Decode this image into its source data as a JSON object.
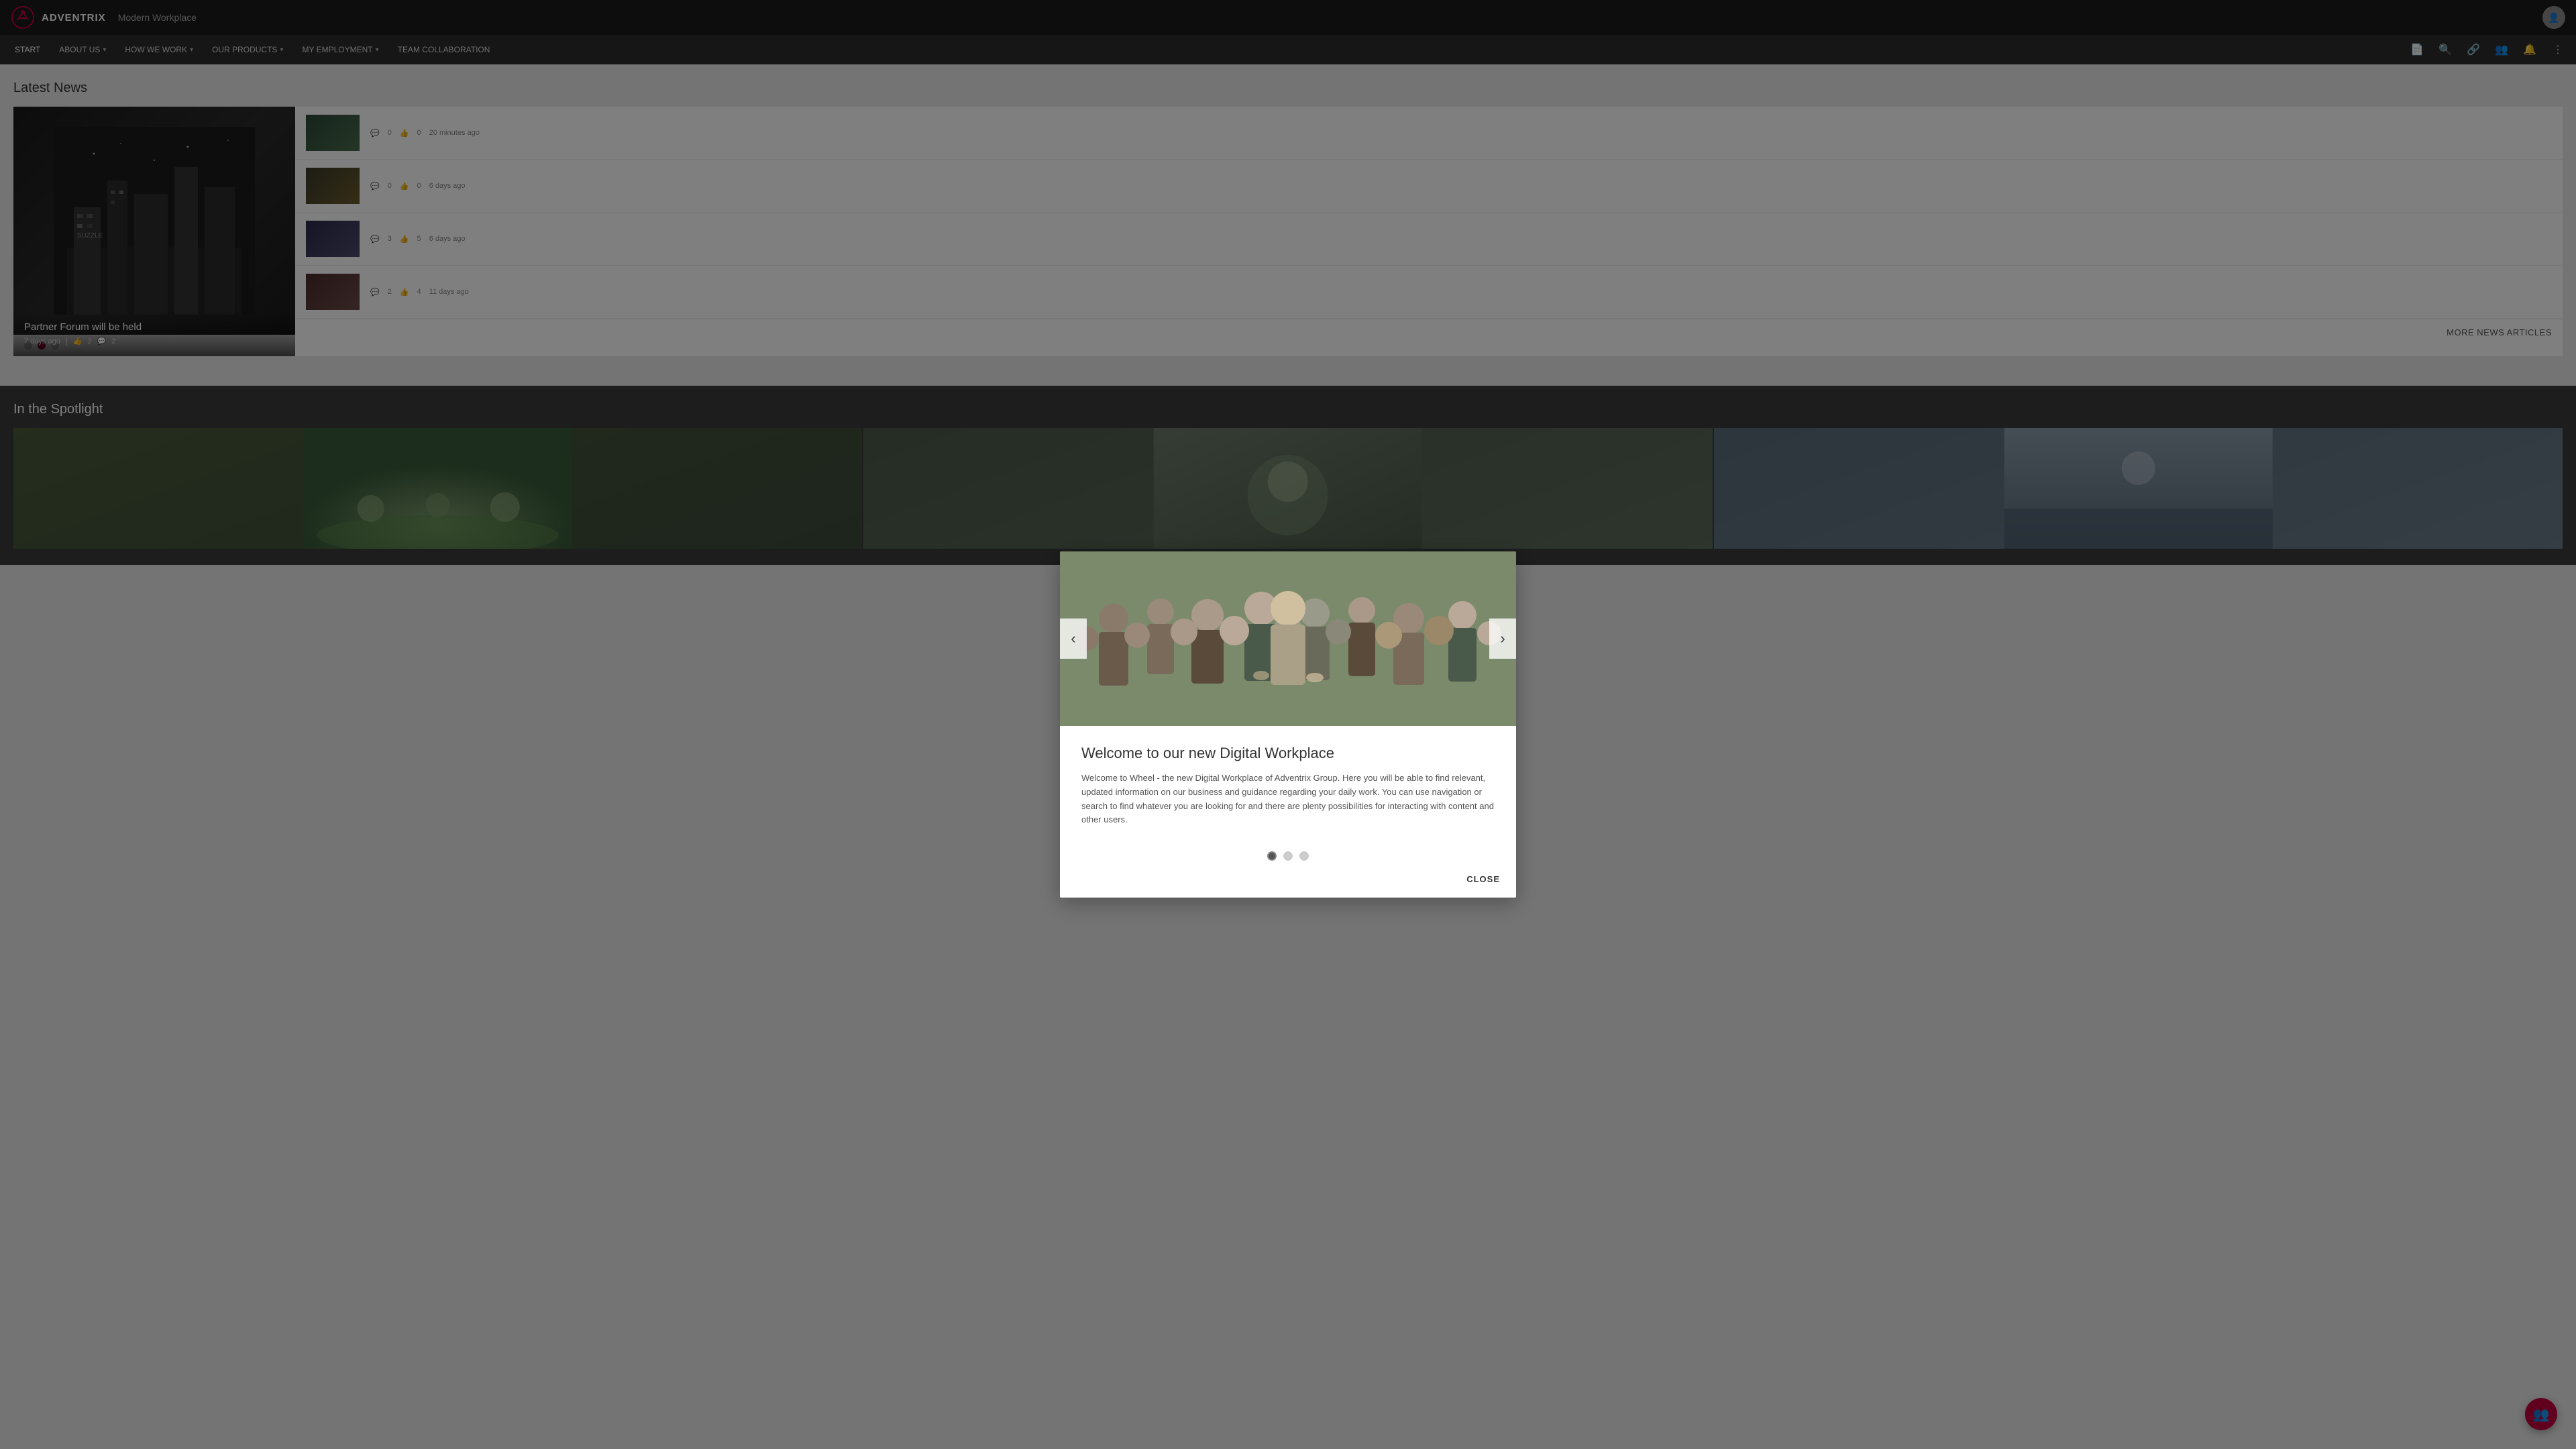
{
  "topbar": {
    "logo_alt": "Adventrix",
    "app_title": "Modern Workplace"
  },
  "navbar": {
    "items": [
      {
        "id": "start",
        "label": "START",
        "has_dropdown": false
      },
      {
        "id": "about",
        "label": "ABOUT US",
        "has_dropdown": true
      },
      {
        "id": "how",
        "label": "HOW WE WORK",
        "has_dropdown": true
      },
      {
        "id": "products",
        "label": "OUR PRODUCTS",
        "has_dropdown": true
      },
      {
        "id": "employment",
        "label": "MY EMPLOYMENT",
        "has_dropdown": true
      },
      {
        "id": "collab",
        "label": "TEAM COLLABORATION",
        "has_dropdown": false
      }
    ]
  },
  "latest_news": {
    "section_title": "Latest News",
    "main_card": {
      "title": "Partner Forum will be held",
      "time_ago": "7 days ago",
      "likes": "2",
      "comments": "2"
    },
    "list_items": [
      {
        "title": "",
        "comments": "0",
        "likes": "0",
        "time_ago": "20 minutes ago"
      },
      {
        "title": "",
        "comments": "0",
        "likes": "0",
        "time_ago": "6 days ago"
      },
      {
        "title": "",
        "comments": "3",
        "likes": "5",
        "time_ago": "6 days ago"
      },
      {
        "title": "",
        "comments": "2",
        "likes": "4",
        "time_ago": "11 days ago"
      }
    ],
    "more_link": "MORE NEWS ARTICLES"
  },
  "modal": {
    "title": "Welcome to our new Digital Workplace",
    "body": "Welcome to Wheel - the new Digital Workplace of Adventrix Group. Here you will be able to find relevant, updated information on our business and guidance regarding your daily work. You can use navigation or search to find whatever you are looking for and there are plenty possibilities for interacting with content and other users.",
    "close_label": "CLOSE",
    "dots_count": 3,
    "active_dot": 0,
    "prev_label": "‹",
    "next_label": "›"
  },
  "spotlight": {
    "section_title": "In the Spotlight"
  },
  "carousel": {
    "active_dot": 1
  }
}
